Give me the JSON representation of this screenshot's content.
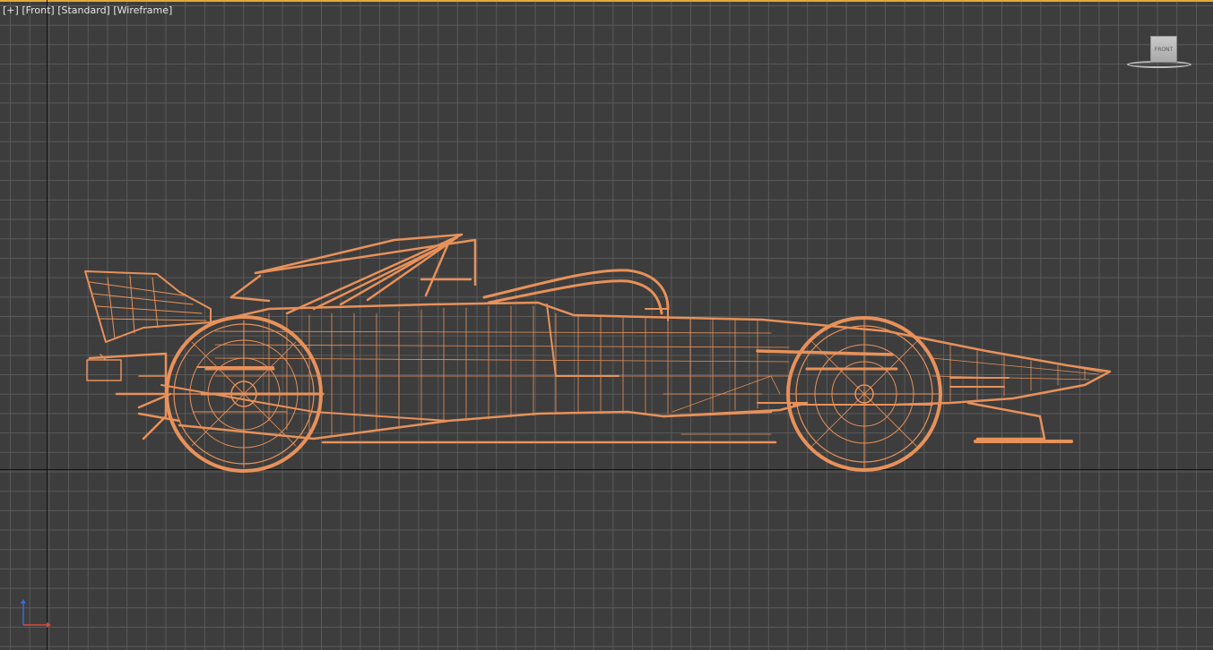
{
  "viewport": {
    "menu_label": "[+]",
    "view_label": "[Front]",
    "shading_label": "[Standard]",
    "display_label": "[Wireframe]"
  },
  "viewcube": {
    "face_label": "FRONT"
  },
  "colors": {
    "background": "#3d3d3d",
    "grid": "#5a5a5a",
    "axis": "#141414",
    "wireframe": "#e8915a",
    "active_border": "#e3a93a"
  },
  "icons": [
    "viewcube-icon",
    "axis-gizmo-icon"
  ]
}
